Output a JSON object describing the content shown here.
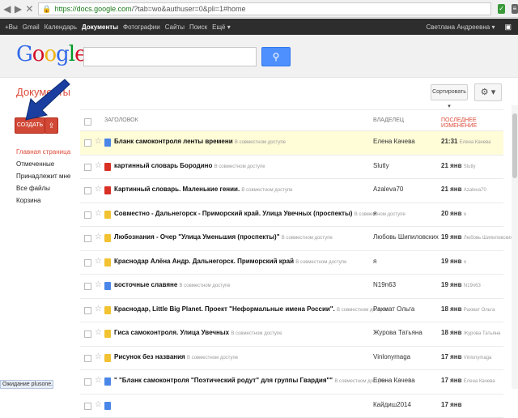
{
  "browser": {
    "url_host": "https://docs.google.com",
    "url_path": "/?tab=wo&authuser=0&pli=1#home"
  },
  "gbar": {
    "items": [
      "+Вы",
      "Gmail",
      "Календарь",
      "Документы",
      "Фотографии",
      "Сайты",
      "Поиск",
      "Ещё ▾"
    ],
    "account": "Светлана Андреевна ▾"
  },
  "header": {
    "logo": "Google",
    "search_placeholder": "",
    "search_button": "Q"
  },
  "page": {
    "title": "Документы",
    "sort_label": "Сортировать ▾",
    "gear_label": "⚙ ▾"
  },
  "actions": {
    "create_label": "СОЗДАТЬ",
    "upload_label": "⇪"
  },
  "sidebar": {
    "items": [
      "Главная страница",
      "Отмеченные",
      "Принадлежит мне",
      "Все файлы",
      "Корзина"
    ]
  },
  "list": {
    "headers": {
      "title": "ЗАГОЛОВОК",
      "owner": "ВЛАДЕЛЕЦ",
      "modified": "ПОСЛЕДНЕЕ ИЗМЕНЕНИЕ"
    },
    "rows": [
      {
        "type": "doc",
        "title": "Бланк самоконтроля ленты времени",
        "shared": "В совместном доступе",
        "owner": "Елена Качева",
        "date": "21:31",
        "by": "Елена Качева"
      },
      {
        "type": "pdf",
        "title": "картинный словарь Бородино",
        "shared": "В совместном доступе",
        "owner": "Slutly",
        "date": "21 янв",
        "by": "Slutly"
      },
      {
        "type": "pdf",
        "title": "Картинный словарь. Маленькие гении.",
        "shared": "В совместном доступе",
        "owner": "Azaleva70",
        "date": "21 янв",
        "by": "Azaleva70"
      },
      {
        "type": "pres",
        "title": "Совместно - Дальнегорск - Приморский край. Улица Увечных (проспекты)",
        "shared": "В совместном доступе",
        "owner": "я",
        "date": "20 янв",
        "by": "я"
      },
      {
        "type": "pres",
        "title": "Любознания - Очер \"Улица Уменьшия (проспекты)\"",
        "shared": "В совместном доступе",
        "owner": "Любовь Шипиловских",
        "date": "19 янв",
        "by": "Любовь Шипиловских"
      },
      {
        "type": "pres",
        "title": "Краснодар Алёна Андр. Дальнегорск. Приморский край",
        "shared": "В совместном доступе",
        "owner": "я",
        "date": "19 янв",
        "by": "я"
      },
      {
        "type": "doc",
        "title": "восточные славяне",
        "shared": "В совместном доступе",
        "owner": "N19n63",
        "date": "19 янв",
        "by": "N19n63"
      },
      {
        "type": "pres",
        "title": "Краснодар, Little Big Planet. Проект \"Неформальные имена России\".",
        "shared": "В совместном доступе",
        "owner": "Рахмат Ольга",
        "date": "18 янв",
        "by": "Рахмат Ольга"
      },
      {
        "type": "pres",
        "title": "Гиса самоконтроля. Улица Увечных",
        "shared": "В совместном доступе",
        "owner": "Журова Татьяна",
        "date": "18 янв",
        "by": "Журова Татьяна"
      },
      {
        "type": "pres",
        "title": "Рисунок без названия",
        "shared": "В совместном доступе",
        "owner": "Vinlonymaga",
        "date": "17 янв",
        "by": "Vinlonymaga"
      },
      {
        "type": "doc",
        "title": "\" \"Бланк самоконтроля \"Поэтический родут\" для группы Гвардия\"\"",
        "shared": "В совместном доступе",
        "owner": "Елена Качева",
        "date": "17 янв",
        "by": "Елена Качева"
      },
      {
        "type": "doc",
        "title": "",
        "shared": "",
        "owner": "Кайдиш2014",
        "date": "17 янв",
        "by": ""
      }
    ]
  },
  "status_bar": {
    "text": "Ожидание plusone.google.com"
  },
  "colors": {
    "accent": "#dd4b39",
    "highlight_row": "#fffcd8",
    "search_blue": "#4d90fe",
    "gbar": "#2d2d2d"
  }
}
